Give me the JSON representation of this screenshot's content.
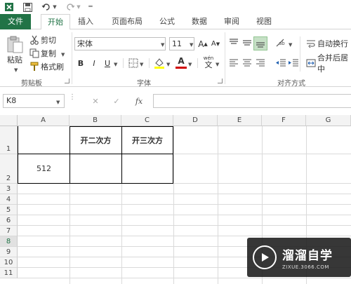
{
  "ribbon_tabs": {
    "file": "文件",
    "home": "开始",
    "insert": "插入",
    "page_layout": "页面布局",
    "formulas": "公式",
    "data": "数据",
    "review": "审阅",
    "view": "视图"
  },
  "clipboard": {
    "paste": "粘贴",
    "cut": "剪切",
    "copy": "复制",
    "format_painter": "格式刷",
    "label": "剪贴板"
  },
  "font_group": {
    "font_name": "宋体",
    "font_size": "11",
    "grow": "A",
    "shrink": "A",
    "bold": "B",
    "italic": "I",
    "underline": "U",
    "font_color_letter": "A",
    "phonetic": "wén",
    "phonetic_char": "文",
    "label": "字体"
  },
  "alignment": {
    "wrap_text": "自动换行",
    "merge_center": "合并后居中",
    "label": "对齐方式"
  },
  "formula_bar": {
    "name_box": "K8",
    "fx": "fx",
    "cancel": "✕",
    "enter": "✓"
  },
  "columns": [
    "A",
    "B",
    "C",
    "D",
    "E",
    "F",
    "G"
  ],
  "rows": [
    "1",
    "2",
    "3",
    "4",
    "5",
    "6",
    "7",
    "8",
    "9",
    "10",
    "11"
  ],
  "cells": {
    "B1": "开二次方",
    "C1": "开三次方",
    "A2": "512"
  },
  "watermark": {
    "name": "溜溜自学",
    "url": "ZIXUE.3066.COM"
  },
  "colors": {
    "accent": "#217346",
    "grid": "#dadada",
    "header_bg": "#f3f3f3",
    "font_color_bar": "#d00000",
    "fill_color_bar": "#ffff00"
  }
}
